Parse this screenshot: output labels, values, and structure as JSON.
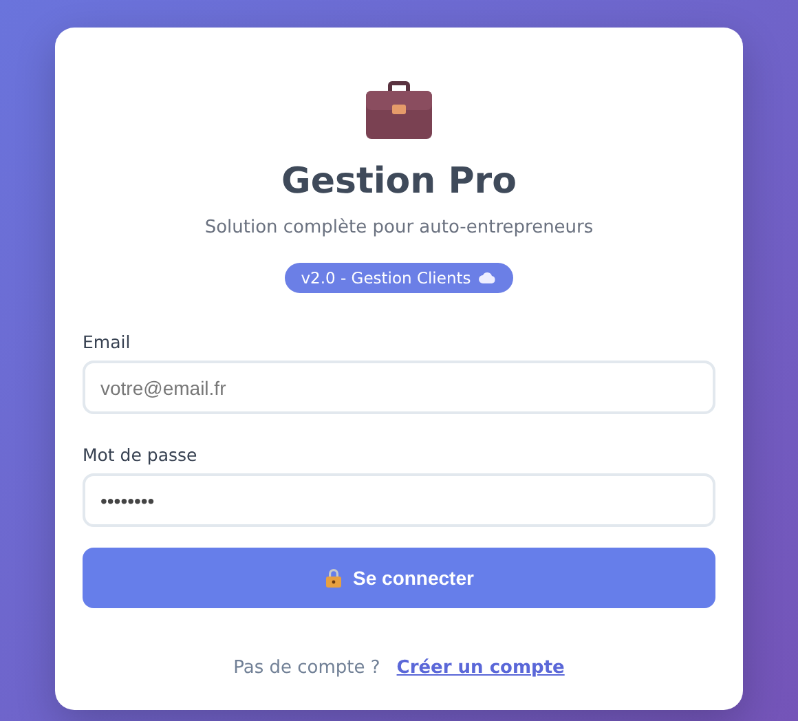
{
  "header": {
    "title": "Gestion Pro",
    "subtitle": "Solution complète pour auto-entrepreneurs",
    "badge": "v2.0 - Gestion Clients"
  },
  "fields": [
    {
      "label": "Email",
      "placeholder": "votre@email.fr"
    },
    {
      "label": "Mot de passe",
      "value": "••••••••"
    }
  ],
  "submit": {
    "label": "Se connecter"
  },
  "footer": {
    "text": "Pas de compte ?",
    "link": "Créer un compte"
  }
}
